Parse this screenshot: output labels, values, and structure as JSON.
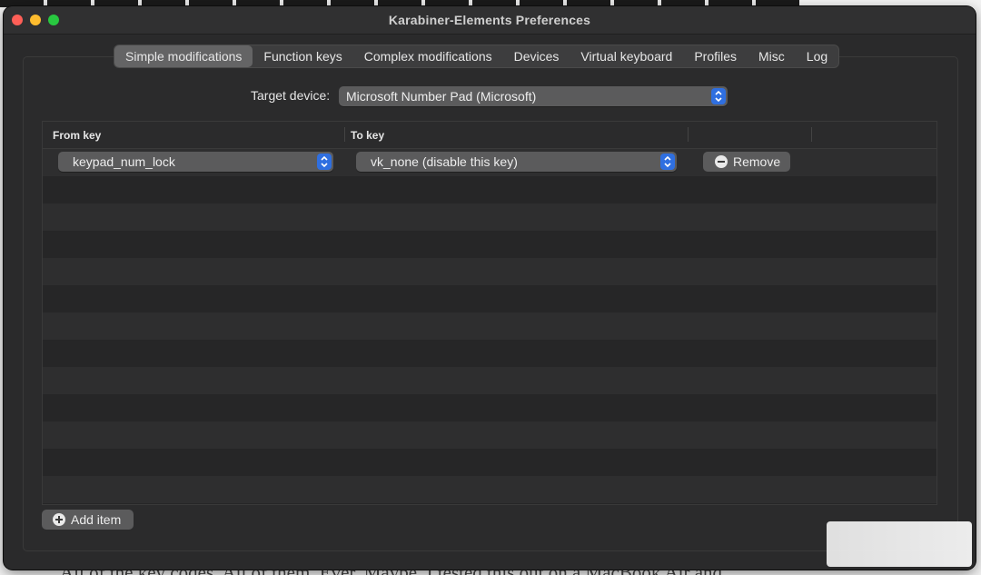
{
  "window": {
    "title": "Karabiner-Elements Preferences"
  },
  "tabs": [
    {
      "label": "Simple modifications",
      "active": true
    },
    {
      "label": "Function keys",
      "active": false
    },
    {
      "label": "Complex modifications",
      "active": false
    },
    {
      "label": "Devices",
      "active": false
    },
    {
      "label": "Virtual keyboard",
      "active": false
    },
    {
      "label": "Profiles",
      "active": false
    },
    {
      "label": "Misc",
      "active": false
    },
    {
      "label": "Log",
      "active": false
    }
  ],
  "target": {
    "label": "Target device:",
    "value": "Microsoft Number Pad (Microsoft)"
  },
  "table": {
    "columns": [
      "From key",
      "To key"
    ],
    "rows": [
      {
        "from": "keypad_num_lock",
        "to": "vk_none (disable this key)",
        "remove_label": "Remove"
      }
    ]
  },
  "add_item_label": "Add item",
  "background": {
    "text": "All of the key codes. All of them. Ever. Maybe. I tested this out on a MacBook Air and"
  },
  "colors": {
    "window_bg": "#2a2a2b",
    "accent_blue": "#2f6fe0",
    "close": "#ff5f57",
    "minimize": "#febc2e",
    "maximize": "#28c840"
  }
}
